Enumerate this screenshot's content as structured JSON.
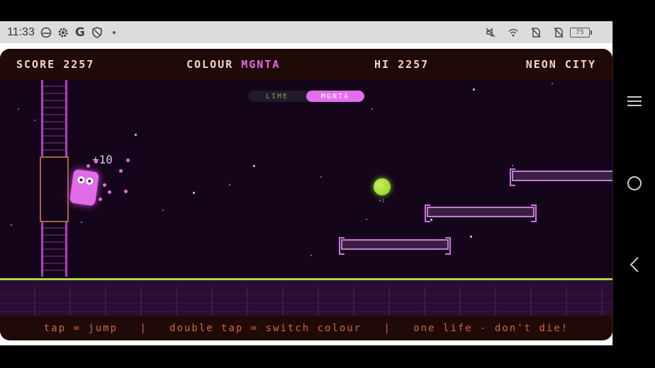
{
  "statusbar": {
    "time": "11:33",
    "icons_left": [
      "hat-icon",
      "gear-icon",
      "google-icon",
      "shield-icon",
      "dot-icon"
    ],
    "icons_right": [
      "mute-icon",
      "wifi-icon",
      "no-sim-icon",
      "no-sim-icon"
    ],
    "battery": "75"
  },
  "hud": {
    "score_label": "SCORE",
    "score": "2257",
    "colour_label": "COLOUR",
    "colour": "MGNTA",
    "hi_label": "HI",
    "hi": "2257",
    "level": "NEON CITY"
  },
  "toggle": {
    "options": [
      "LIME",
      "MGNTA"
    ],
    "selected": "MGNTA"
  },
  "popup": "+10",
  "orb_label": "+1",
  "footer": "tap = jump   |   double tap = switch colour   |   one life - don't die!",
  "colors": {
    "magenta": "#e26be8",
    "lime": "#a9d84a",
    "hud_bg": "#200a08",
    "hud_text": "#f4d8c0",
    "footer_text": "#c86a3c"
  }
}
